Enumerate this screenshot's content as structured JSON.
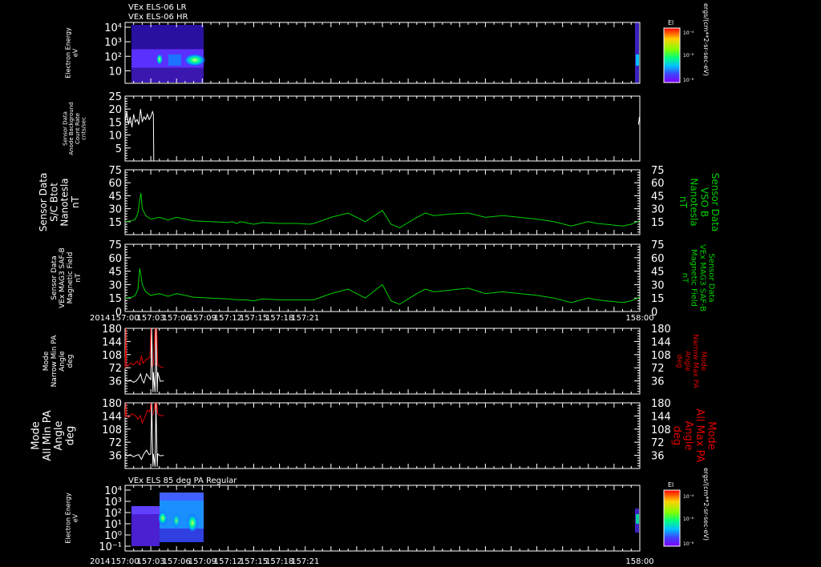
{
  "header": {
    "line1": "VEx ELS-06 LR",
    "line2": "VEx ELS-06 HR",
    "bottom_panel_title": "VEx ELS 85 deg PA Regular"
  },
  "colorbar": {
    "label": "El",
    "units": "ergs/(cm**2-sr-sec-eV)",
    "ticks": [
      "10⁻⁴",
      "10⁻⁶",
      "10⁻⁸"
    ]
  },
  "colors": {
    "white": "#ffffff",
    "green": "#00d000",
    "red": "#e00000",
    "background": "#000000"
  },
  "chart_data": [
    {
      "name": "panel-1",
      "type": "heatmap",
      "ylabel": [
        "Electron Energy",
        "eV"
      ],
      "yscale": "log",
      "ytick_labels": [
        "10⁴",
        "10³",
        "10²",
        "10"
      ]
    },
    {
      "name": "panel-2",
      "type": "line",
      "ylabel": [
        "Sensor Data",
        "Anode Background",
        "Count Rate",
        "cnts/sec"
      ],
      "ylim": [
        0,
        25
      ],
      "yticks": [
        5,
        10,
        15,
        20,
        25
      ],
      "series": [
        {
          "color": "white",
          "x": [
            0,
            0.2,
            0.4,
            0.6,
            0.8,
            1.0,
            1.2,
            1.4,
            1.6,
            1.8,
            2.0,
            2.2,
            2.4,
            2.6,
            2.8,
            3.0,
            3.2,
            3.3,
            3.35
          ],
          "y": [
            15,
            19,
            14,
            17,
            13,
            18,
            15,
            16,
            14,
            20,
            15,
            17,
            16,
            18,
            16,
            17,
            19,
            18,
            0
          ]
        },
        {
          "color": "white",
          "x": [
            59.85,
            59.95,
            60.0
          ],
          "y": [
            14,
            17,
            15
          ]
        }
      ]
    },
    {
      "name": "panel-3",
      "type": "line",
      "ylabel": [
        "Sensor Data",
        "S/C Btot",
        "Nanotesla",
        "nT"
      ],
      "ylabel_right": [
        "Sensor Data",
        "VSO B",
        "Nanotesla",
        "nT"
      ],
      "ylim": [
        0,
        75
      ],
      "yticks": [
        15,
        30,
        45,
        60,
        75
      ],
      "series": [
        {
          "color": "green",
          "x": [
            0,
            0.8,
            1.2,
            1.5,
            1.7,
            1.85,
            2.0,
            2.4,
            3.0,
            4.0,
            5.0,
            6.0,
            8.0,
            10.0,
            12.0,
            12.5,
            13.0,
            13.5,
            14.0,
            14.5,
            15.0,
            16.0,
            18.0,
            20.0,
            21.5,
            22.0,
            24.0,
            26.0,
            28.0,
            30.0,
            31.0,
            32.0,
            34.0,
            35.0,
            36.0,
            38.0,
            40.0,
            42.0,
            44.0,
            46.0,
            48.0,
            50.0,
            52.0,
            54.0,
            55.0,
            56.0,
            58.0,
            59.0,
            60.0
          ],
          "y": [
            15,
            16,
            18,
            25,
            40,
            48,
            30,
            22,
            18,
            20,
            17,
            20,
            16,
            15,
            14,
            15,
            13,
            15,
            14,
            13,
            12,
            14,
            13,
            13,
            12,
            13,
            20,
            25,
            15,
            28,
            12,
            8,
            20,
            25,
            22,
            24,
            25,
            20,
            22,
            20,
            18,
            15,
            10,
            15,
            13,
            12,
            10,
            12,
            16
          ]
        }
      ]
    },
    {
      "name": "panel-4",
      "type": "line",
      "ylabel": [
        "Sensor Data",
        "VEx MAG3 SAF-B",
        "Magnetic Field",
        "nT"
      ],
      "ylabel_right": [
        "Sensor Data",
        "VEx MAG3 SAF-B",
        "Magnetic Field",
        "nT"
      ],
      "ylim": [
        0,
        75
      ],
      "yticks": [
        0,
        15,
        30,
        45,
        60,
        75
      ],
      "series": [
        {
          "color": "green",
          "x": [
            0,
            0.8,
            1.2,
            1.5,
            1.7,
            1.85,
            2.0,
            2.4,
            3.0,
            4.0,
            5.0,
            6.0,
            8.0,
            10.0,
            12.0,
            13.0,
            14.0,
            15.0,
            16.0,
            18.0,
            20.0,
            22.0,
            24.0,
            26.0,
            28.0,
            30.0,
            31.0,
            32.0,
            34.0,
            35.0,
            36.0,
            38.0,
            40.0,
            42.0,
            44.0,
            46.0,
            48.0,
            50.0,
            52.0,
            54.0,
            55.0,
            56.0,
            58.0,
            59.0,
            60.0
          ],
          "y": [
            15,
            16,
            18,
            25,
            48,
            40,
            30,
            22,
            18,
            20,
            17,
            20,
            16,
            15,
            14,
            13,
            13,
            12,
            14,
            13,
            13,
            13,
            20,
            25,
            15,
            30,
            12,
            8,
            20,
            25,
            22,
            24,
            26,
            20,
            22,
            20,
            18,
            15,
            10,
            15,
            13,
            12,
            10,
            12,
            16
          ]
        }
      ]
    },
    {
      "name": "panel-5",
      "type": "line",
      "ylabel": [
        "Mode",
        "Narrow Min PA",
        "Angle",
        "deg"
      ],
      "ylabel_right": [
        "Mode",
        "Narrow Max PA",
        "Angle",
        "deg"
      ],
      "ylim": [
        0,
        180
      ],
      "yticks": [
        36,
        72,
        108,
        144,
        180
      ],
      "series": [
        {
          "color": "red",
          "x": [
            0,
            0.1,
            0.15,
            0.3,
            0.6,
            1.0,
            1.4,
            1.7,
            1.9,
            2.1,
            2.5,
            2.9,
            3.0,
            3.1,
            3.3,
            3.5,
            3.6,
            3.7,
            3.8,
            4.1,
            4.3,
            4.5
          ],
          "y": [
            70,
            180,
            80,
            75,
            85,
            80,
            90,
            80,
            105,
            85,
            95,
            100,
            180,
            75,
            80,
            180,
            78,
            180,
            80,
            75,
            73,
            72
          ]
        },
        {
          "color": "white",
          "x": [
            0,
            0.3,
            0.6,
            1.0,
            1.3,
            1.6,
            1.8,
            2.0,
            2.2,
            2.5,
            2.8,
            3.0,
            3.1,
            3.25,
            3.3,
            3.5,
            3.6,
            3.75,
            3.8,
            4.1,
            4.5
          ],
          "y": [
            40,
            35,
            38,
            32,
            36,
            45,
            55,
            38,
            30,
            55,
            45,
            40,
            180,
            5,
            60,
            5,
            180,
            5,
            60,
            35,
            36
          ]
        }
      ]
    },
    {
      "name": "panel-6",
      "type": "line",
      "ylabel": [
        "Mode",
        "All Min PA",
        "Angle",
        "deg"
      ],
      "ylabel_right": [
        "Mode",
        "All Max PA",
        "Angle",
        "deg"
      ],
      "ylim": [
        0,
        180
      ],
      "yticks": [
        36,
        72,
        108,
        144,
        180
      ],
      "series": [
        {
          "color": "red",
          "x": [
            0,
            0.1,
            0.15,
            0.4,
            0.8,
            1.2,
            1.5,
            1.8,
            2.0,
            2.3,
            2.6,
            2.9,
            3.0,
            3.1,
            3.3,
            3.5,
            3.6,
            3.7,
            3.8,
            4.1,
            4.5
          ],
          "y": [
            140,
            180,
            145,
            140,
            150,
            145,
            135,
            145,
            125,
            140,
            160,
            155,
            180,
            145,
            150,
            180,
            145,
            180,
            150,
            145,
            145
          ]
        },
        {
          "color": "white",
          "x": [
            0,
            0.3,
            0.6,
            1.0,
            1.3,
            1.6,
            1.9,
            2.2,
            2.5,
            2.8,
            3.0,
            3.1,
            3.25,
            3.3,
            3.5,
            3.6,
            3.75,
            3.8,
            4.1,
            4.5
          ],
          "y": [
            40,
            35,
            38,
            32,
            36,
            38,
            25,
            40,
            50,
            38,
            40,
            180,
            5,
            40,
            5,
            180,
            5,
            40,
            35,
            36
          ]
        }
      ]
    },
    {
      "name": "panel-7",
      "type": "heatmap",
      "ylabel": [
        "Electron Energy",
        "eV"
      ],
      "yscale": "log",
      "ytick_labels": [
        "10⁴",
        "10³",
        "10²",
        "10¹",
        "10⁰",
        "10⁻¹"
      ]
    }
  ],
  "xaxis": {
    "year": "2014",
    "tick_labels": [
      "157:00",
      "157:03",
      "157:06",
      "157:09",
      "157:12",
      "157:15",
      "157:18",
      "157:21",
      "158:00"
    ]
  }
}
